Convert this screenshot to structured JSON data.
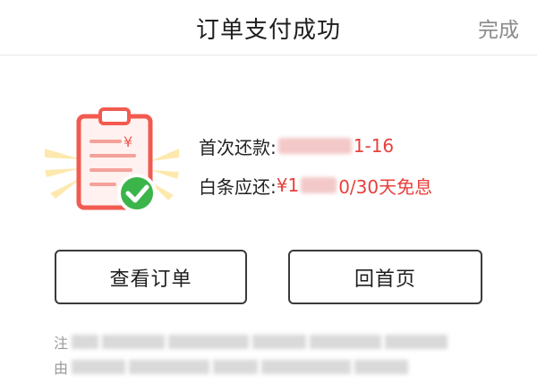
{
  "header": {
    "title": "订单支付成功",
    "done_label": "完成"
  },
  "info": {
    "first_repay_label": "首次还款:",
    "first_repay_value_suffix": "1-16",
    "baitiao_label": "白条应还:",
    "baitiao_value_prefix": "¥1",
    "baitiao_value_suffix": "0/30天免息"
  },
  "buttons": {
    "view_order": "查看订单",
    "back_home": "回首页"
  },
  "notes": {
    "line1_start": "注",
    "line2_start": "由"
  },
  "colors": {
    "accent_red": "#e8403c",
    "check_green": "#3bb54a",
    "clipboard_red": "#f25a50"
  }
}
